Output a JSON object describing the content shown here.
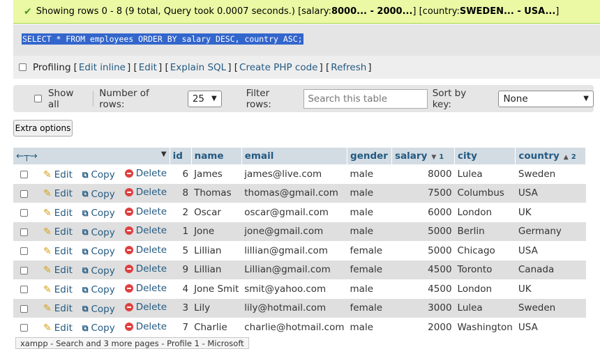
{
  "success": {
    "prefix": "Showing rows 0 - 8 (9 total, Query took 0.0007 seconds.) [salary: ",
    "salary_range": "8000... - 2000...",
    "mid": "] [country: ",
    "country_range": "SWEDEN... - USA...",
    "suffix": "]"
  },
  "sql": "SELECT * FROM employees ORDER BY salary DESC, country ASC;",
  "profiling": {
    "label": "Profiling",
    "links": [
      "Edit inline",
      "Edit",
      "Explain SQL",
      "Create PHP code",
      "Refresh"
    ]
  },
  "navbar": {
    "show_all": "Show all",
    "num_rows_label": "Number of rows:",
    "num_rows_value": "25",
    "filter_label": "Filter rows:",
    "filter_placeholder": "Search this table",
    "sort_label": "Sort by key:",
    "sort_value": "None"
  },
  "extra_options": "Extra options",
  "actions": {
    "edit": "Edit",
    "copy": "Copy",
    "delete": "Delete"
  },
  "columns": {
    "id": "id",
    "name": "name",
    "email": "email",
    "gender": "gender",
    "salary": "salary",
    "salary_order": "1",
    "city": "city",
    "country": "country",
    "country_order": "2"
  },
  "rows": [
    {
      "id": "6",
      "name": "James",
      "email": "james@live.com",
      "gender": "male",
      "salary": "8000",
      "city": "Lulea",
      "country": "Sweden"
    },
    {
      "id": "8",
      "name": "Thomas",
      "email": "thomas@gmail.com",
      "gender": "male",
      "salary": "7500",
      "city": "Columbus",
      "country": "USA"
    },
    {
      "id": "2",
      "name": "Oscar",
      "email": "oscar@gmail.com",
      "gender": "male",
      "salary": "6000",
      "city": "London",
      "country": "UK"
    },
    {
      "id": "1",
      "name": "Jone",
      "email": "jone@gmail.com",
      "gender": "male",
      "salary": "5000",
      "city": "Berlin",
      "country": "Germany"
    },
    {
      "id": "5",
      "name": "Lillian",
      "email": "lillian@gmail.com",
      "gender": "female",
      "salary": "5000",
      "city": "Chicago",
      "country": "USA"
    },
    {
      "id": "9",
      "name": "Lillian",
      "email": "Lillian@gmail.com",
      "gender": "female",
      "salary": "4500",
      "city": "Toronto",
      "country": "Canada"
    },
    {
      "id": "4",
      "name": "Jone Smit",
      "email": "smit@yahoo.com",
      "gender": "male",
      "salary": "4500",
      "city": "London",
      "country": "UK"
    },
    {
      "id": "3",
      "name": "Lily",
      "email": "lily@hotmail.com",
      "gender": "female",
      "salary": "3000",
      "city": "Lulea",
      "country": "Sweden"
    },
    {
      "id": "7",
      "name": "Charlie",
      "email": "charlie@hotmail.com",
      "gender": "male",
      "salary": "2000",
      "city": "Washington",
      "country": "USA"
    }
  ],
  "tooltip": "xampp - Search and 3 more pages - Profile 1 - Microsoft"
}
